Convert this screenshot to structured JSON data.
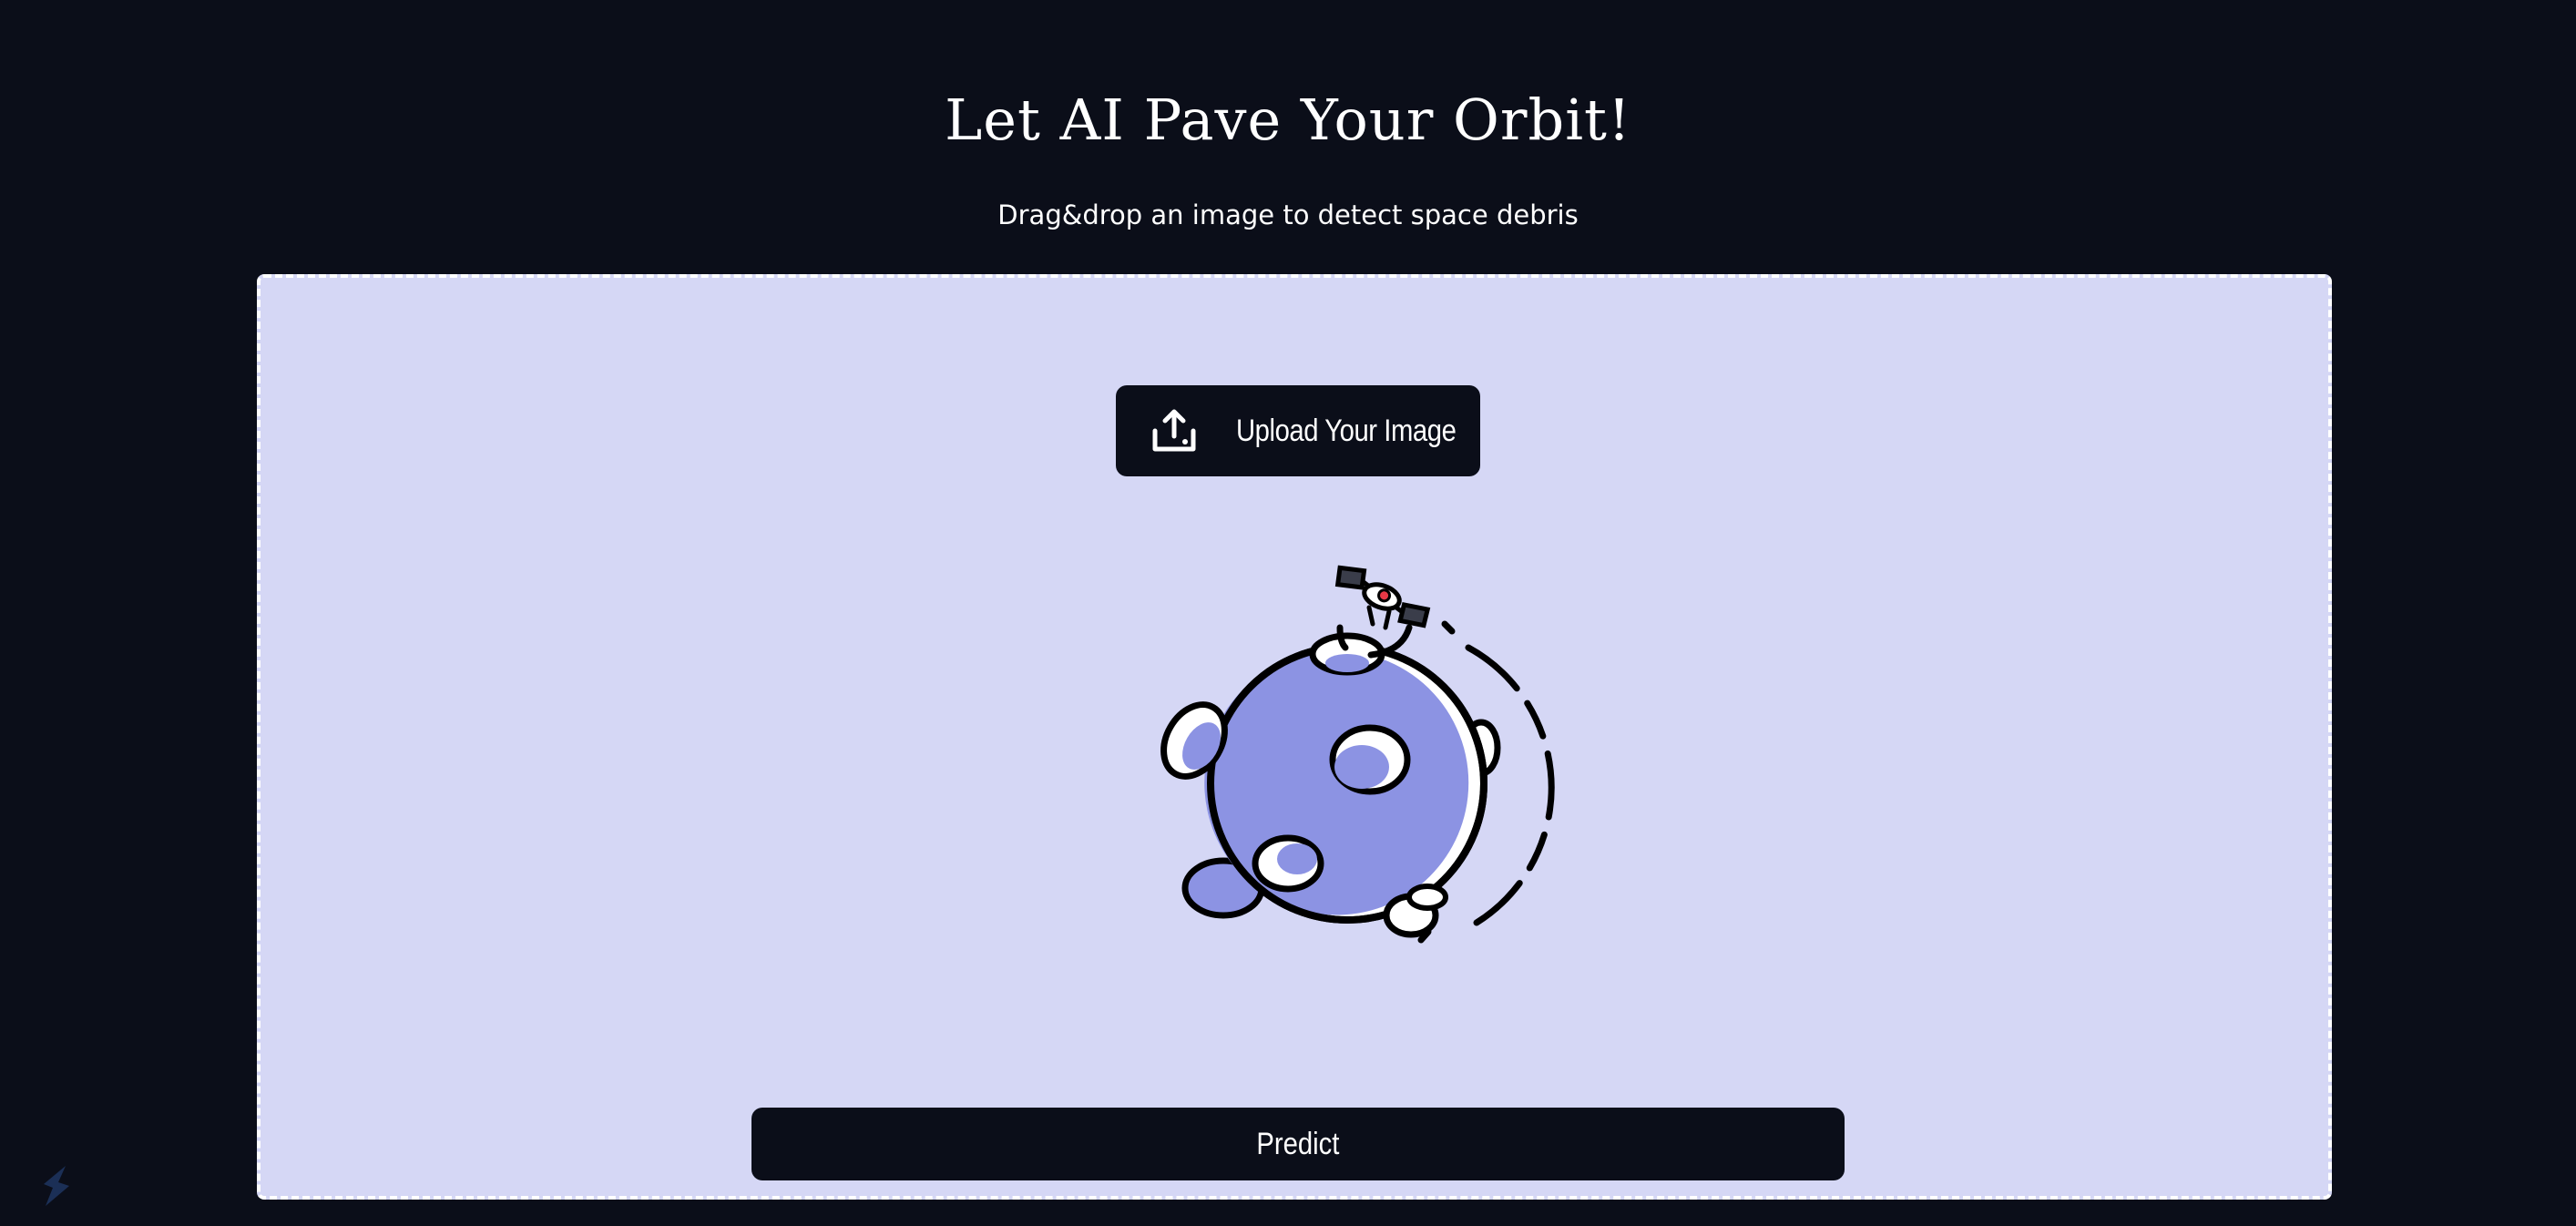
{
  "header": {
    "title": "Let AI Pave Your Orbit!",
    "subtitle": "Drag&drop an image to detect space debris"
  },
  "drop_zone": {
    "upload_label": "Upload Your Image",
    "upload_icon": "upload-icon",
    "illustration": "planet-with-satellite-illustration"
  },
  "actions": {
    "predict_label": "Predict"
  },
  "colors": {
    "background": "#0b0e19",
    "drop_zone": "#d5d7f5",
    "planet": "#8c93e3",
    "button": "#0b0e19",
    "button_text": "#ffffff"
  }
}
